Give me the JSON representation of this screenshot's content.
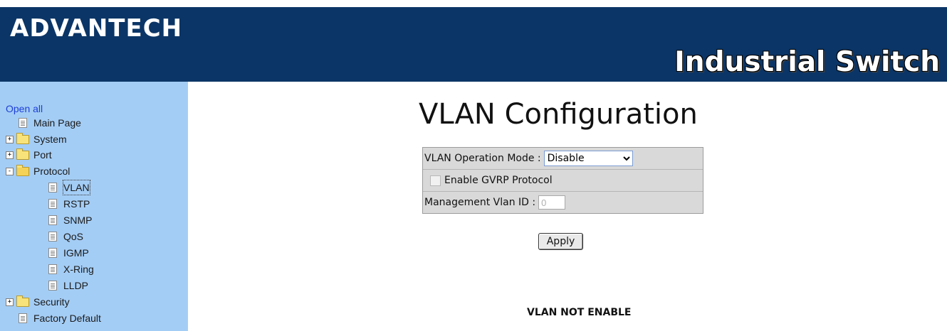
{
  "header": {
    "brand": "ADVANTECH",
    "product": "Industrial Switch"
  },
  "sidebar": {
    "open_all": "Open all",
    "items": [
      {
        "label": "Main Page",
        "type": "page",
        "level": 0
      },
      {
        "label": "System",
        "type": "folder",
        "level": 0,
        "expander": "+"
      },
      {
        "label": "Port",
        "type": "folder",
        "level": 0,
        "expander": "+"
      },
      {
        "label": "Protocol",
        "type": "folder-open",
        "level": 0,
        "expander": "-"
      },
      {
        "label": "VLAN",
        "type": "page",
        "level": 1,
        "selected": true
      },
      {
        "label": "RSTP",
        "type": "page",
        "level": 1
      },
      {
        "label": "SNMP",
        "type": "page",
        "level": 1
      },
      {
        "label": "QoS",
        "type": "page",
        "level": 1
      },
      {
        "label": "IGMP",
        "type": "page",
        "level": 1
      },
      {
        "label": "X-Ring",
        "type": "page",
        "level": 1
      },
      {
        "label": "LLDP",
        "type": "page",
        "level": 1
      },
      {
        "label": "Security",
        "type": "folder",
        "level": 0,
        "expander": "+"
      },
      {
        "label": "Factory Default",
        "type": "page",
        "level": 0
      }
    ]
  },
  "main": {
    "title": "VLAN Configuration",
    "operation_mode_label": "VLAN Operation Mode :",
    "operation_mode_value": "Disable",
    "gvrp_label": "Enable GVRP Protocol",
    "gvrp_checked": false,
    "mgmt_vlan_label": "Management Vlan ID :",
    "mgmt_vlan_value": "0",
    "apply_label": "Apply",
    "status_text": "VLAN NOT ENABLE"
  },
  "colors": {
    "header_bg": "#0b3566",
    "sidebar_bg": "#a4cdf5",
    "link": "#1d3fd6"
  }
}
